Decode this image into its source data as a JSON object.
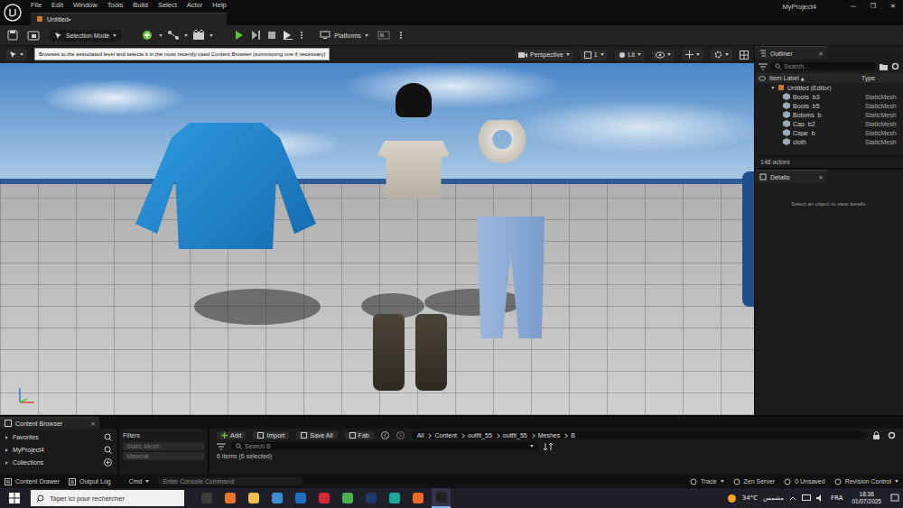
{
  "app": {
    "project": "MyProject4",
    "level_tab": "Untitled•"
  },
  "menu": [
    "File",
    "Edit",
    "Window",
    "Tools",
    "Build",
    "Select",
    "Actor",
    "Help"
  ],
  "window_controls": [
    "—",
    "❐",
    "✕"
  ],
  "toolbar": {
    "selection_mode": "Selection Mode",
    "platforms": "Platforms"
  },
  "tooltip": "Browses to the associated level and selects it in the most recently used Content Browser (summoning one if necessary)",
  "viewport": {
    "perspective": "Perspective",
    "view_index": "1",
    "lit": "Lit"
  },
  "outliner": {
    "title": "Outliner",
    "close": "×",
    "search_placeholder": "Search...",
    "columns": [
      "Item Label",
      "Type"
    ],
    "sort_arrow": "▲",
    "root": {
      "label": "Untitled (Editor)",
      "expanded": true
    },
    "rows": [
      {
        "label": "Boots_b3",
        "type": "StaticMesh"
      },
      {
        "label": "Boots_b5",
        "type": "StaticMesh"
      },
      {
        "label": "Botoms_b",
        "type": "StaticMesh"
      },
      {
        "label": "Cap_b2",
        "type": "StaticMesh"
      },
      {
        "label": "Cape_b",
        "type": "StaticMesh"
      },
      {
        "label": "cloth",
        "type": "StaticMesh"
      }
    ],
    "count": "148 actors"
  },
  "details": {
    "title": "Details",
    "close": "×",
    "empty": "Select an object to view details."
  },
  "content_browser": {
    "title": "Content Browser",
    "close": "×",
    "sources": [
      {
        "label": "Favorites",
        "expanded": false
      },
      {
        "label": "MyProject4",
        "expanded": false
      },
      {
        "label": "Collections",
        "expanded": false
      }
    ],
    "filters_title": "Filters",
    "filters": [
      "Static Mesh",
      "Material"
    ],
    "buttons": [
      "Add",
      "Import",
      "Save All",
      "Fab"
    ],
    "path": [
      "All",
      "Content",
      "outfit_55",
      "outfit_55",
      "Meshes",
      "B"
    ],
    "search_placeholder": "Search B",
    "summary": "6 items (6 selected)"
  },
  "status_bar": {
    "left": [
      "Content Drawer",
      "Output Log"
    ],
    "cmd": "Cmd",
    "console_placeholder": "Enter Console Command",
    "right": [
      "Trace",
      "Zen Server",
      "0 Unsaved",
      "Revision Control"
    ]
  },
  "taskbar": {
    "search_placeholder": "Taper ici pour rechercher",
    "weather": "34°C",
    "weather_text": "مشمس",
    "language": "FRA",
    "time": "18:36",
    "date": "01/07/2025",
    "apps": [
      {
        "color": "#3a3a3a",
        "active": false
      },
      {
        "color": "#e8742b",
        "active": false
      },
      {
        "color": "#f2c14e",
        "active": false
      },
      {
        "color": "#3b8ed8",
        "active": false
      },
      {
        "color": "#1f6fc2",
        "active": false
      },
      {
        "color": "#d3273a",
        "active": false
      },
      {
        "color": "#4caf50",
        "active": false
      },
      {
        "color": "#1d3a6b",
        "active": false
      },
      {
        "color": "#1fa79a",
        "active": false
      },
      {
        "color": "#f06a28",
        "active": false
      },
      {
        "color": "#222222",
        "active": true
      }
    ]
  }
}
